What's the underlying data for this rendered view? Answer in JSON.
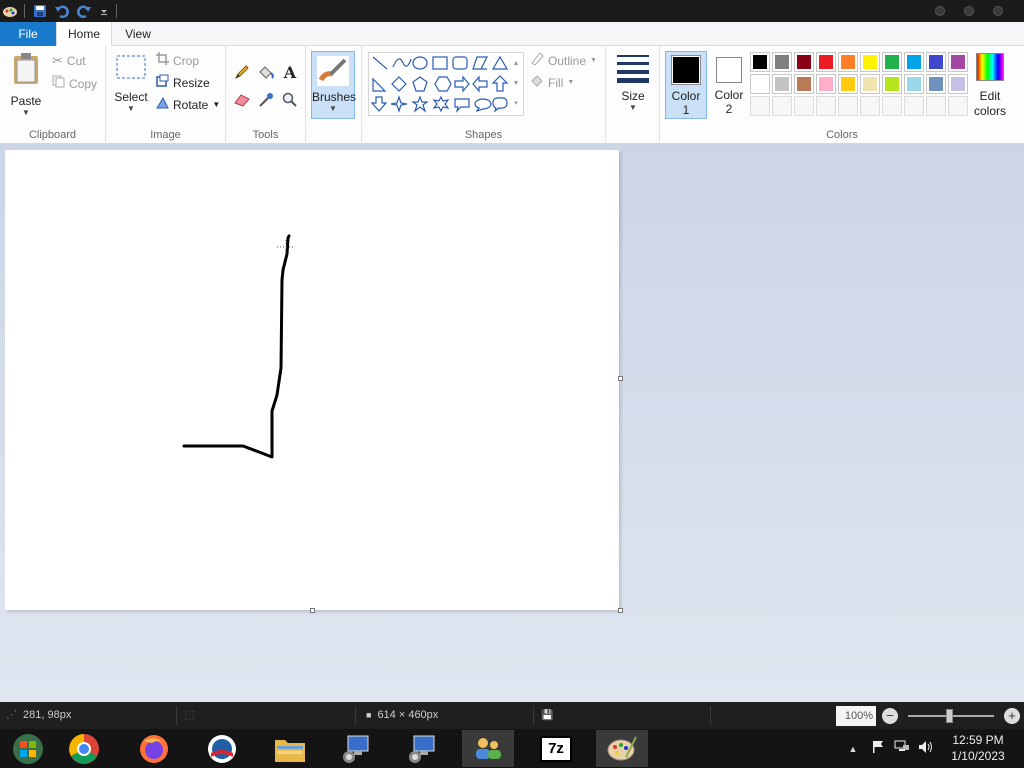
{
  "tabs": {
    "file": "File",
    "home": "Home",
    "view": "View"
  },
  "clipboard": {
    "paste": "Paste",
    "cut": "Cut",
    "copy": "Copy",
    "label": "Clipboard"
  },
  "image": {
    "select": "Select",
    "crop": "Crop",
    "resize": "Resize",
    "rotate": "Rotate",
    "label": "Image"
  },
  "tools": {
    "label": "Tools"
  },
  "brushes": {
    "label": "Brushes"
  },
  "shapes": {
    "outline": "Outline",
    "fill": "Fill",
    "label": "Shapes"
  },
  "size": {
    "label": "Size"
  },
  "colors": {
    "color1": "Color",
    "color1_num": "1",
    "color2": "Color",
    "color2_num": "2",
    "edit": "Edit",
    "edit2": "colors",
    "label": "Colors",
    "color1_value": "#000000",
    "color2_value": "#ffffff",
    "row1": [
      "#000000",
      "#7f7f7f",
      "#880015",
      "#ed1c24",
      "#ff7f27",
      "#fff200",
      "#22b14c",
      "#00a2e8",
      "#3f48cc",
      "#a349a4"
    ],
    "row2": [
      "#ffffff",
      "#c3c3c3",
      "#b97a57",
      "#ffaec9",
      "#ffc90e",
      "#efe4b0",
      "#b5e61d",
      "#99d9ea",
      "#7092be",
      "#c8bfe7"
    ]
  },
  "status": {
    "cursor_pos": "281, 98px",
    "canvas_size": "614 × 460px",
    "zoom": "100%"
  },
  "clock": {
    "time": "12:59 PM",
    "date": "1/10/2023"
  },
  "taskbar": {
    "seven_zip": "7z"
  },
  "accent": "#1979ca"
}
